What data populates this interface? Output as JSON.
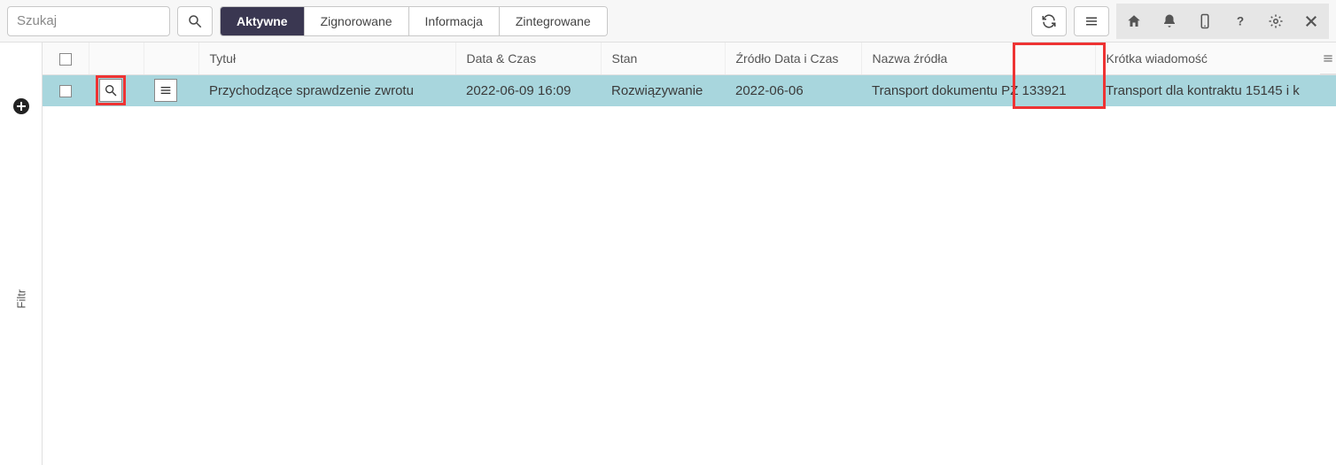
{
  "toolbar": {
    "search_placeholder": "Szukaj",
    "tabs": {
      "aktywne": "Aktywne",
      "zignorowane": "Zignorowane",
      "informacja": "Informacja",
      "zintegrowane": "Zintegrowane"
    }
  },
  "filter_rail": {
    "label": "Filtr"
  },
  "table": {
    "headers": {
      "title": "Tytuł",
      "datetime": "Data & Czas",
      "state": "Stan",
      "src_datetime": "Źródło Data i Czas",
      "src_name": "Nazwa źródła",
      "short_msg": "Krótka wiadomość"
    },
    "rows": [
      {
        "title": "Przychodzące sprawdzenie zwrotu",
        "datetime": "2022-06-09 16:09",
        "state": "Rozwiązywanie",
        "src_datetime": "2022-06-06",
        "src_name": "Transport dokumentu PZ 133921",
        "short_msg": "Transport dla kontraktu 15145 i k"
      }
    ]
  }
}
